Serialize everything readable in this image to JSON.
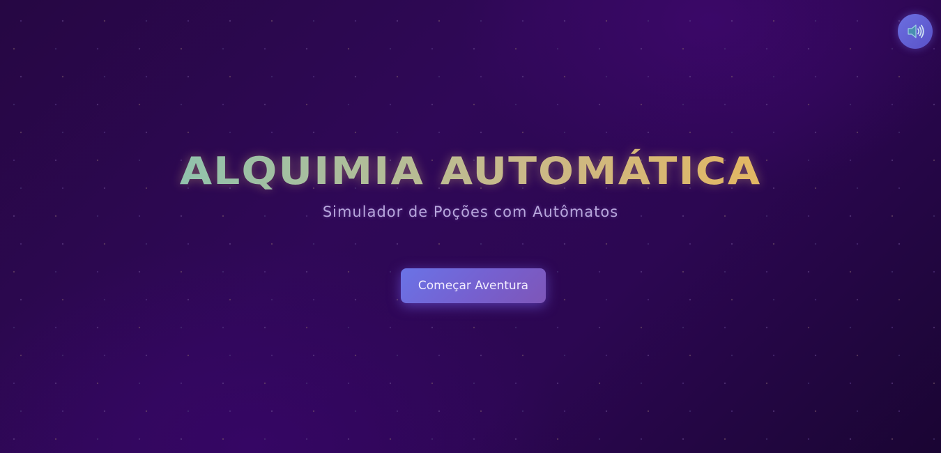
{
  "header": {
    "sound_icon": "speaker-volume-icon"
  },
  "hero": {
    "title": "ALQUIMIA AUTOMÁTICA",
    "subtitle": "Simulador de Poções com Autômatos",
    "start_button_label": "Começar Aventura"
  },
  "colors": {
    "background_dark": "#260743",
    "background_mid": "#2f0857",
    "title_gradient_start": "#6fc7c0",
    "title_gradient_end": "#f0b552",
    "subtitle": "#b7a6dc",
    "button_gradient_start": "#6a73e6",
    "button_gradient_end": "#7e56b8",
    "sound_button": "#6b6fe0"
  }
}
